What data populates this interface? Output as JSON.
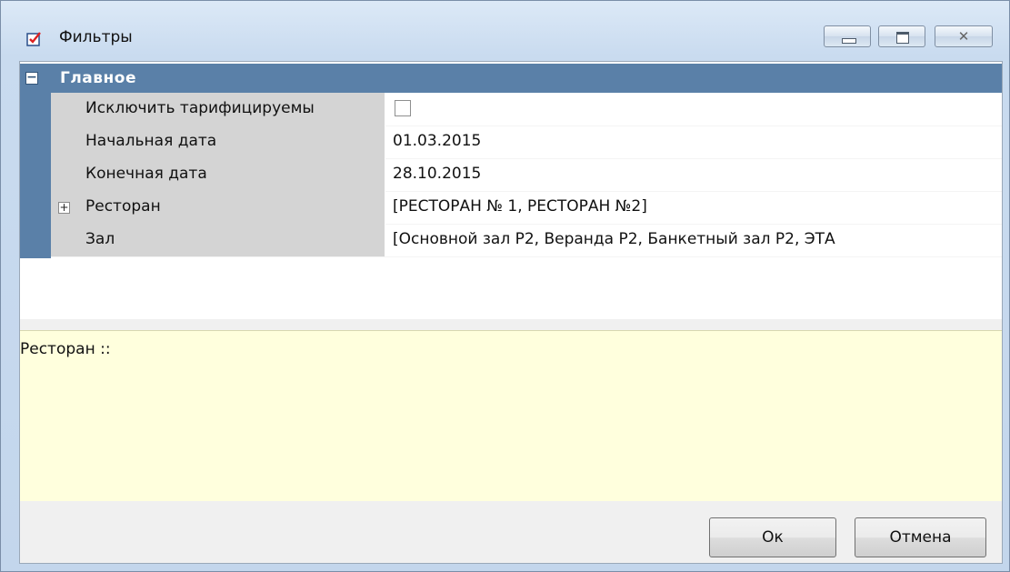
{
  "window": {
    "title": "Фильтры",
    "icon": "checklist-icon"
  },
  "grid": {
    "category": {
      "label": "Главное",
      "toggle": "−"
    },
    "rows": [
      {
        "name": "Исключить тарифицируемы",
        "value": "",
        "type": "checkbox",
        "checked": false
      },
      {
        "name": "Начальная дата",
        "value": "01.03.2015"
      },
      {
        "name": "Конечная дата",
        "value": "28.10.2015"
      },
      {
        "name": "Ресторан",
        "value": "[РЕСТОРАН № 1, РЕСТОРАН №2]",
        "expandable": true,
        "expander": "+"
      },
      {
        "name": "Зал",
        "value": "[Основной зал  Р2, Веранда Р2, Банкетный зал Р2, ЭТА"
      }
    ]
  },
  "description": {
    "text": "Ресторан ::"
  },
  "buttons": {
    "ok": "Ок",
    "cancel": "Отмена"
  }
}
